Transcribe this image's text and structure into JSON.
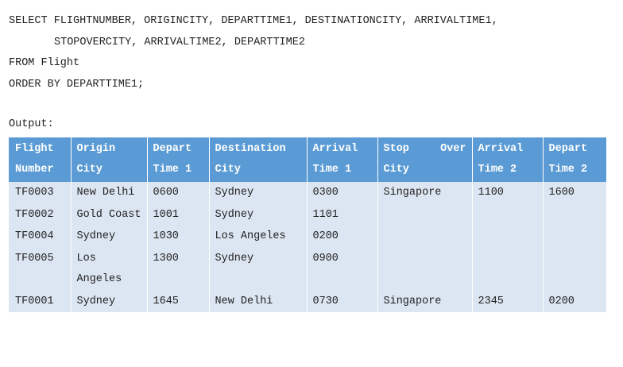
{
  "sql": {
    "line1": "SELECT FLIGHTNUMBER, ORIGINCITY, DEPARTTIME1, DESTINATIONCITY, ARRIVALTIME1,",
    "line2": "STOPOVERCITY, ARRIVALTIME2, DEPARTTIME2",
    "line3": "FROM Flight",
    "line4": "ORDER BY DEPARTTIME1;"
  },
  "output_label": "Output:",
  "table": {
    "headers": [
      {
        "line1": "Flight",
        "line2": "Number"
      },
      {
        "line1": "Origin",
        "line2": "City"
      },
      {
        "line1": "Depart",
        "line2": "Time 1"
      },
      {
        "line1": "Destination",
        "line2": "City"
      },
      {
        "line1": "Arrival",
        "line2": "Time 1"
      },
      {
        "line1a": "Stop",
        "line1b": "Over",
        "line2": "City"
      },
      {
        "line1": "Arrival",
        "line2": "Time 2"
      },
      {
        "line1": "Depart",
        "line2": "Time 2"
      }
    ],
    "rows": [
      [
        "TF0003",
        "New Delhi",
        "0600",
        "Sydney",
        "0300",
        "Singapore",
        "1100",
        "1600"
      ],
      [
        "TF0002",
        "Gold Coast",
        "1001",
        "Sydney",
        "1101",
        "",
        "",
        ""
      ],
      [
        "TF0004",
        "Sydney",
        "1030",
        "Los Angeles",
        "0200",
        "",
        "",
        ""
      ],
      [
        "TF0005",
        "Los Angeles",
        "1300",
        "Sydney",
        "0900",
        "",
        "",
        ""
      ],
      [
        "TF0001",
        "Sydney",
        "1645",
        "New Delhi",
        "0730",
        "Singapore",
        "2345",
        "0200"
      ]
    ]
  }
}
